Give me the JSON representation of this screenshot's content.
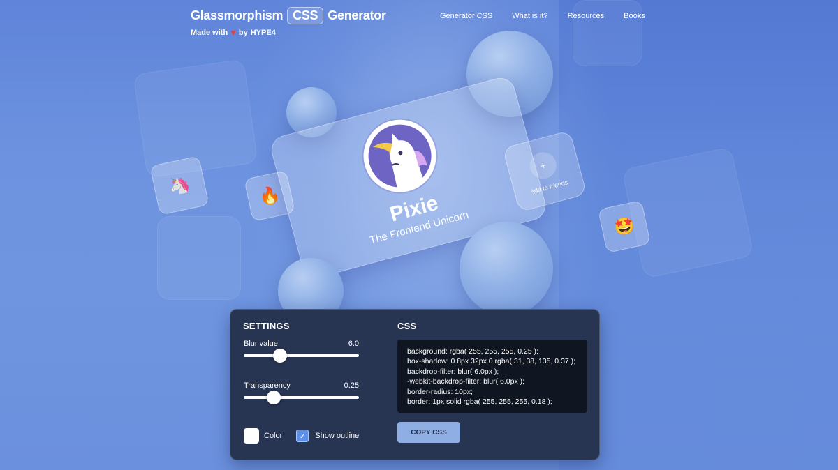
{
  "header": {
    "title_pre": "Glassmorphism",
    "title_badge": "CSS",
    "title_post": "Generator",
    "made_with": "Made with",
    "heart": "♥",
    "by": "by",
    "brand_link": "HYPE4"
  },
  "nav": [
    "Generator CSS",
    "What is it?",
    "Resources",
    "Books"
  ],
  "preview": {
    "name": "Pixie",
    "tagline": "The Frontend Unicorn",
    "add_friends": "Add to friends",
    "plus": "+",
    "emojis": {
      "unicorn": "🦄",
      "fire": "🔥",
      "star_struck": "🤩"
    }
  },
  "settings": {
    "title": "SETTINGS",
    "blur_label": "Blur value",
    "blur_value": "6.0",
    "blur_fraction": 0.3,
    "transparency_label": "Transparency",
    "transparency_value": "0.25",
    "transparency_fraction": 0.25,
    "color_label": "Color",
    "color_value": "#ffffff",
    "outline_label": "Show outline",
    "outline_checked": true
  },
  "css": {
    "title": "CSS",
    "lines": [
      "background: rgba( 255, 255, 255, 0.25 );",
      "box-shadow: 0 8px 32px 0 rgba( 31, 38, 135, 0.37 );",
      "backdrop-filter: blur( 6.0px );",
      "-webkit-backdrop-filter: blur( 6.0px );",
      "border-radius: 10px;",
      "border: 1px solid rgba( 255, 255, 255, 0.18 );"
    ],
    "copy_button": "COPY CSS"
  },
  "colors": {
    "panel": "#273552",
    "accent": "#5c8fe8",
    "button": "#8eaee4",
    "code_bg": "#0f1521"
  }
}
